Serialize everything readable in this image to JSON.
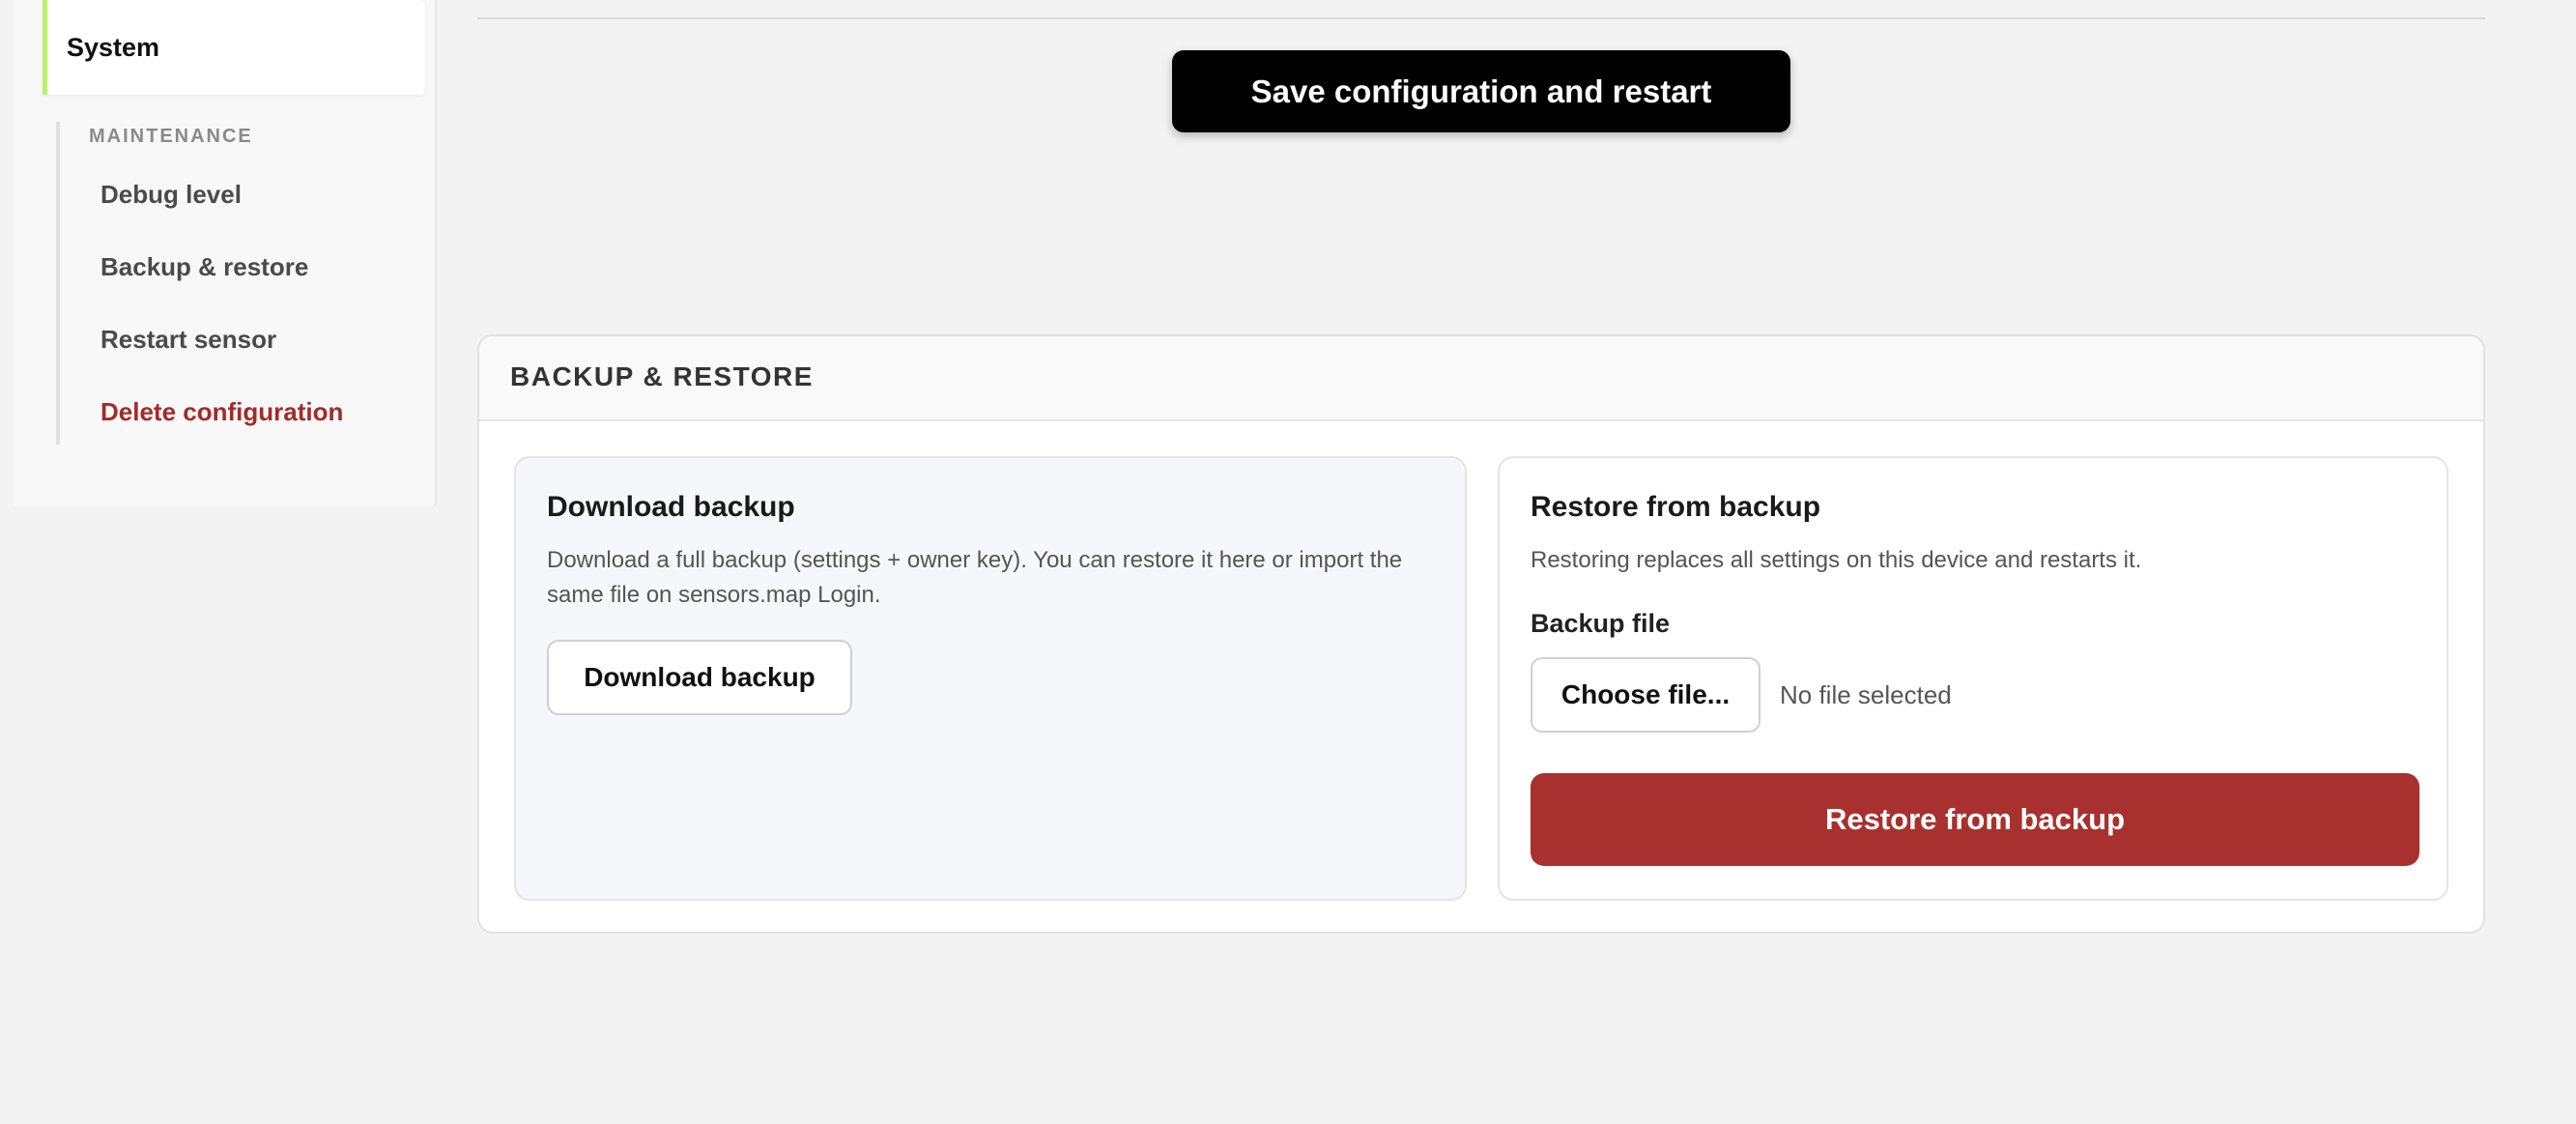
{
  "sidebar": {
    "active_item": "System",
    "section_heading": "MAINTENANCE",
    "items": [
      {
        "label": "Debug level"
      },
      {
        "label": "Backup & restore"
      },
      {
        "label": "Restart sensor"
      },
      {
        "label": "Delete configuration"
      }
    ]
  },
  "toolbar": {
    "save_label": "Save configuration and restart"
  },
  "backup_card": {
    "title": "BACKUP & RESTORE",
    "download": {
      "title": "Download backup",
      "description": "Download a full backup (settings + owner key). You can restore it here or import the same file on sensors.map Login.",
      "button_label": "Download backup"
    },
    "restore": {
      "title": "Restore from backup",
      "description": "Restoring replaces all settings on this device and restarts it.",
      "field_label": "Backup file",
      "choose_label": "Choose file...",
      "file_status": "No file selected",
      "button_label": "Restore from backup"
    }
  },
  "colors": {
    "active_accent": "#b6f26b",
    "danger": "#a52a2a",
    "restore_button": "#a8302e",
    "save_button": "#000000",
    "page_background": "#f3f3f3"
  }
}
